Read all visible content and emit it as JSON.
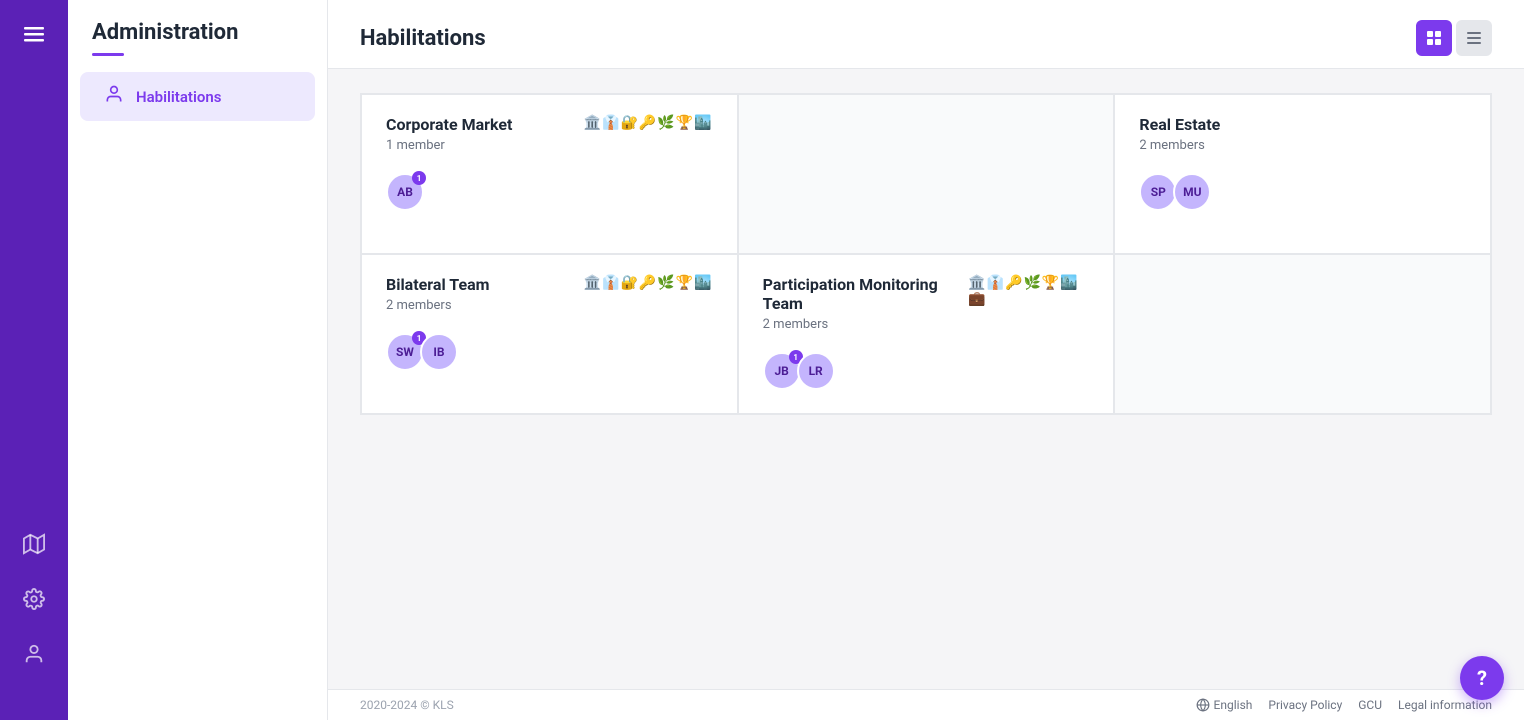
{
  "app": {
    "title": "Administration",
    "copyright": "2020-2024 © KLS"
  },
  "sidebar": {
    "title": "Administration",
    "items": [
      {
        "label": "Habilitations",
        "icon": "👤",
        "active": true
      }
    ]
  },
  "page": {
    "title": "Habilitations",
    "view_grid_label": "Grid view",
    "view_list_label": "List view"
  },
  "teams": [
    {
      "name": "Corporate Market",
      "members_count": "1 member",
      "icons": "🏛️👔🔐🔑🌿🏆🏙️",
      "avatars": [
        {
          "initials": "AB",
          "badge": "1"
        }
      ]
    },
    {
      "name": "",
      "empty": true
    },
    {
      "name": "Real Estate",
      "members_count": "2 members",
      "icons": "",
      "avatars": [
        {
          "initials": "SP",
          "badge": null
        },
        {
          "initials": "MU",
          "badge": null
        }
      ]
    },
    {
      "name": "Bilateral Team",
      "members_count": "2 members",
      "icons": "🏛️👔🔐🔑🌿🏆🏙️",
      "avatars": [
        {
          "initials": "SW",
          "badge": "1"
        },
        {
          "initials": "IB",
          "badge": null
        }
      ]
    },
    {
      "name": "Participation Monitoring Team",
      "members_count": "2 members",
      "icons": "🏛️👔🔑🌿🏆🏙️💼",
      "avatars": [
        {
          "initials": "JB",
          "badge": "1"
        },
        {
          "initials": "LR",
          "badge": null
        }
      ]
    },
    {
      "name": "",
      "empty": true
    }
  ],
  "footer": {
    "copyright": "2020-2024 © KLS",
    "lang": "English",
    "links": [
      "Privacy Policy",
      "GCU",
      "Legal information"
    ]
  },
  "help": {
    "label": "?"
  },
  "nav": {
    "menu_icon": "☰",
    "icons": [
      "🗺️",
      "⚙️",
      "👤"
    ]
  }
}
